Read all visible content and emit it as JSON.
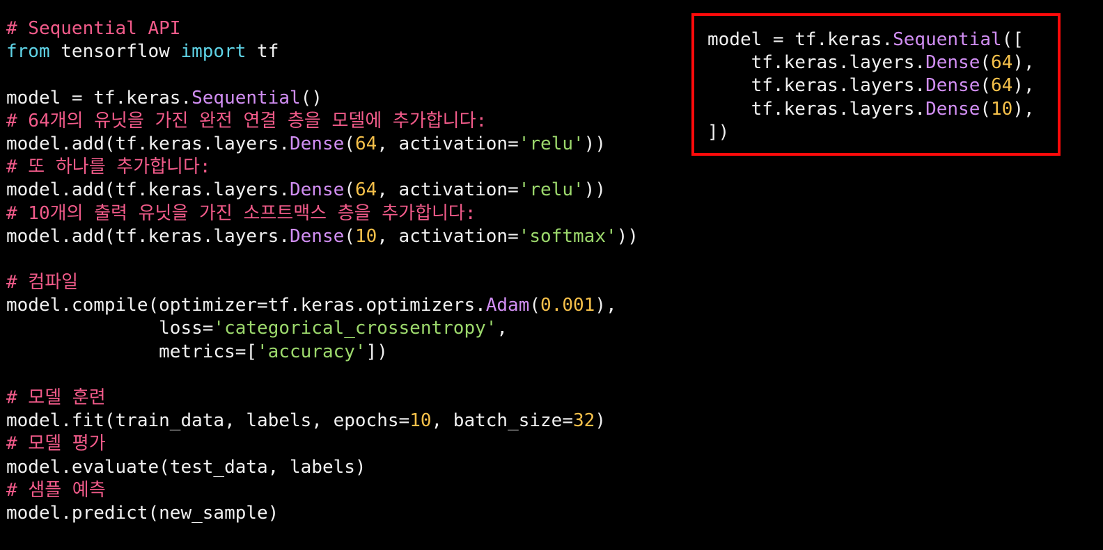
{
  "colors": {
    "background": "#000000",
    "plain": "#f0f0f0",
    "comment": "#f25b8a",
    "keyword": "#5fd3e6",
    "class": "#d18ef3",
    "number": "#f5c04a",
    "string": "#9cd86c",
    "highlight_border": "#ff0a0a"
  },
  "main_code": {
    "lines": [
      [
        {
          "t": "comment",
          "v": "# Sequential API"
        }
      ],
      [
        {
          "t": "kw",
          "v": "from"
        },
        {
          "t": "plain",
          "v": " tensorflow "
        },
        {
          "t": "kw",
          "v": "import"
        },
        {
          "t": "plain",
          "v": " tf"
        }
      ],
      [],
      [
        {
          "t": "plain",
          "v": "model = tf.keras."
        },
        {
          "t": "cls",
          "v": "Sequential"
        },
        {
          "t": "plain",
          "v": "()"
        }
      ],
      [
        {
          "t": "comment",
          "v": "# 64개의 유닛을 가진 완전 연결 층을 모델에 추가합니다:"
        }
      ],
      [
        {
          "t": "plain",
          "v": "model.add(tf.keras.layers."
        },
        {
          "t": "cls",
          "v": "Dense"
        },
        {
          "t": "plain",
          "v": "("
        },
        {
          "t": "num",
          "v": "64"
        },
        {
          "t": "plain",
          "v": ", activation="
        },
        {
          "t": "str",
          "v": "'relu'"
        },
        {
          "t": "plain",
          "v": "))"
        }
      ],
      [
        {
          "t": "comment",
          "v": "# 또 하나를 추가합니다:"
        }
      ],
      [
        {
          "t": "plain",
          "v": "model.add(tf.keras.layers."
        },
        {
          "t": "cls",
          "v": "Dense"
        },
        {
          "t": "plain",
          "v": "("
        },
        {
          "t": "num",
          "v": "64"
        },
        {
          "t": "plain",
          "v": ", activation="
        },
        {
          "t": "str",
          "v": "'relu'"
        },
        {
          "t": "plain",
          "v": "))"
        }
      ],
      [
        {
          "t": "comment",
          "v": "# 10개의 출력 유닛을 가진 소프트맥스 층을 추가합니다:"
        }
      ],
      [
        {
          "t": "plain",
          "v": "model.add(tf.keras.layers."
        },
        {
          "t": "cls",
          "v": "Dense"
        },
        {
          "t": "plain",
          "v": "("
        },
        {
          "t": "num",
          "v": "10"
        },
        {
          "t": "plain",
          "v": ", activation="
        },
        {
          "t": "str",
          "v": "'softmax'"
        },
        {
          "t": "plain",
          "v": "))"
        }
      ],
      [],
      [
        {
          "t": "comment",
          "v": "# 컴파일"
        }
      ],
      [
        {
          "t": "plain",
          "v": "model.compile(optimizer=tf.keras.optimizers."
        },
        {
          "t": "cls",
          "v": "Adam"
        },
        {
          "t": "plain",
          "v": "("
        },
        {
          "t": "num",
          "v": "0.001"
        },
        {
          "t": "plain",
          "v": "),"
        }
      ],
      [
        {
          "t": "plain",
          "v": "              loss="
        },
        {
          "t": "str",
          "v": "'categorical_crossentropy'"
        },
        {
          "t": "plain",
          "v": ","
        }
      ],
      [
        {
          "t": "plain",
          "v": "              metrics=["
        },
        {
          "t": "str",
          "v": "'accuracy'"
        },
        {
          "t": "plain",
          "v": "])"
        }
      ],
      [],
      [
        {
          "t": "comment",
          "v": "# 모델 훈련"
        }
      ],
      [
        {
          "t": "plain",
          "v": "model.fit(train_data, labels, epochs="
        },
        {
          "t": "num",
          "v": "10"
        },
        {
          "t": "plain",
          "v": ", batch_size="
        },
        {
          "t": "num",
          "v": "32"
        },
        {
          "t": "plain",
          "v": ")"
        }
      ],
      [
        {
          "t": "comment",
          "v": "# 모델 평가"
        }
      ],
      [
        {
          "t": "plain",
          "v": "model.evaluate(test_data, labels)"
        }
      ],
      [
        {
          "t": "comment",
          "v": "# 샘플 예측"
        }
      ],
      [
        {
          "t": "plain",
          "v": "model.predict(new_sample)"
        }
      ]
    ]
  },
  "highlight_code": {
    "lines": [
      [
        {
          "t": "plain",
          "v": "model = tf.keras."
        },
        {
          "t": "cls",
          "v": "Sequential"
        },
        {
          "t": "plain",
          "v": "(["
        }
      ],
      [
        {
          "t": "plain",
          "v": "    tf.keras.layers."
        },
        {
          "t": "cls",
          "v": "Dense"
        },
        {
          "t": "plain",
          "v": "("
        },
        {
          "t": "num",
          "v": "64"
        },
        {
          "t": "plain",
          "v": "),"
        }
      ],
      [
        {
          "t": "plain",
          "v": "    tf.keras.layers."
        },
        {
          "t": "cls",
          "v": "Dense"
        },
        {
          "t": "plain",
          "v": "("
        },
        {
          "t": "num",
          "v": "64"
        },
        {
          "t": "plain",
          "v": "),"
        }
      ],
      [
        {
          "t": "plain",
          "v": "    tf.keras.layers."
        },
        {
          "t": "cls",
          "v": "Dense"
        },
        {
          "t": "plain",
          "v": "("
        },
        {
          "t": "num",
          "v": "10"
        },
        {
          "t": "plain",
          "v": "),"
        }
      ],
      [
        {
          "t": "plain",
          "v": "])"
        }
      ]
    ]
  }
}
